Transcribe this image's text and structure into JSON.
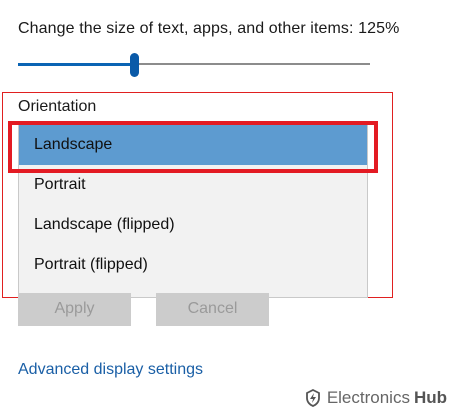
{
  "display": {
    "scale_label": "Change the size of text, apps, and other items: 125%",
    "scale_slider_value": 0.33,
    "accent_color": "#0a64b4"
  },
  "orientation": {
    "label": "Orientation",
    "options": [
      "Landscape",
      "Portrait",
      "Landscape (flipped)",
      "Portrait (flipped)"
    ],
    "selected": "Landscape",
    "selected_color": "#5d9bd0"
  },
  "buttons": {
    "apply_label": "Apply",
    "cancel_label": "Cancel"
  },
  "links": {
    "advanced_display": "Advanced display settings"
  },
  "annotation": {
    "highlight_color": "#e31b23"
  },
  "watermark": {
    "word1": "Electronics",
    "word2": "Hub",
    "icon": "electronics-hub-logo-icon"
  }
}
